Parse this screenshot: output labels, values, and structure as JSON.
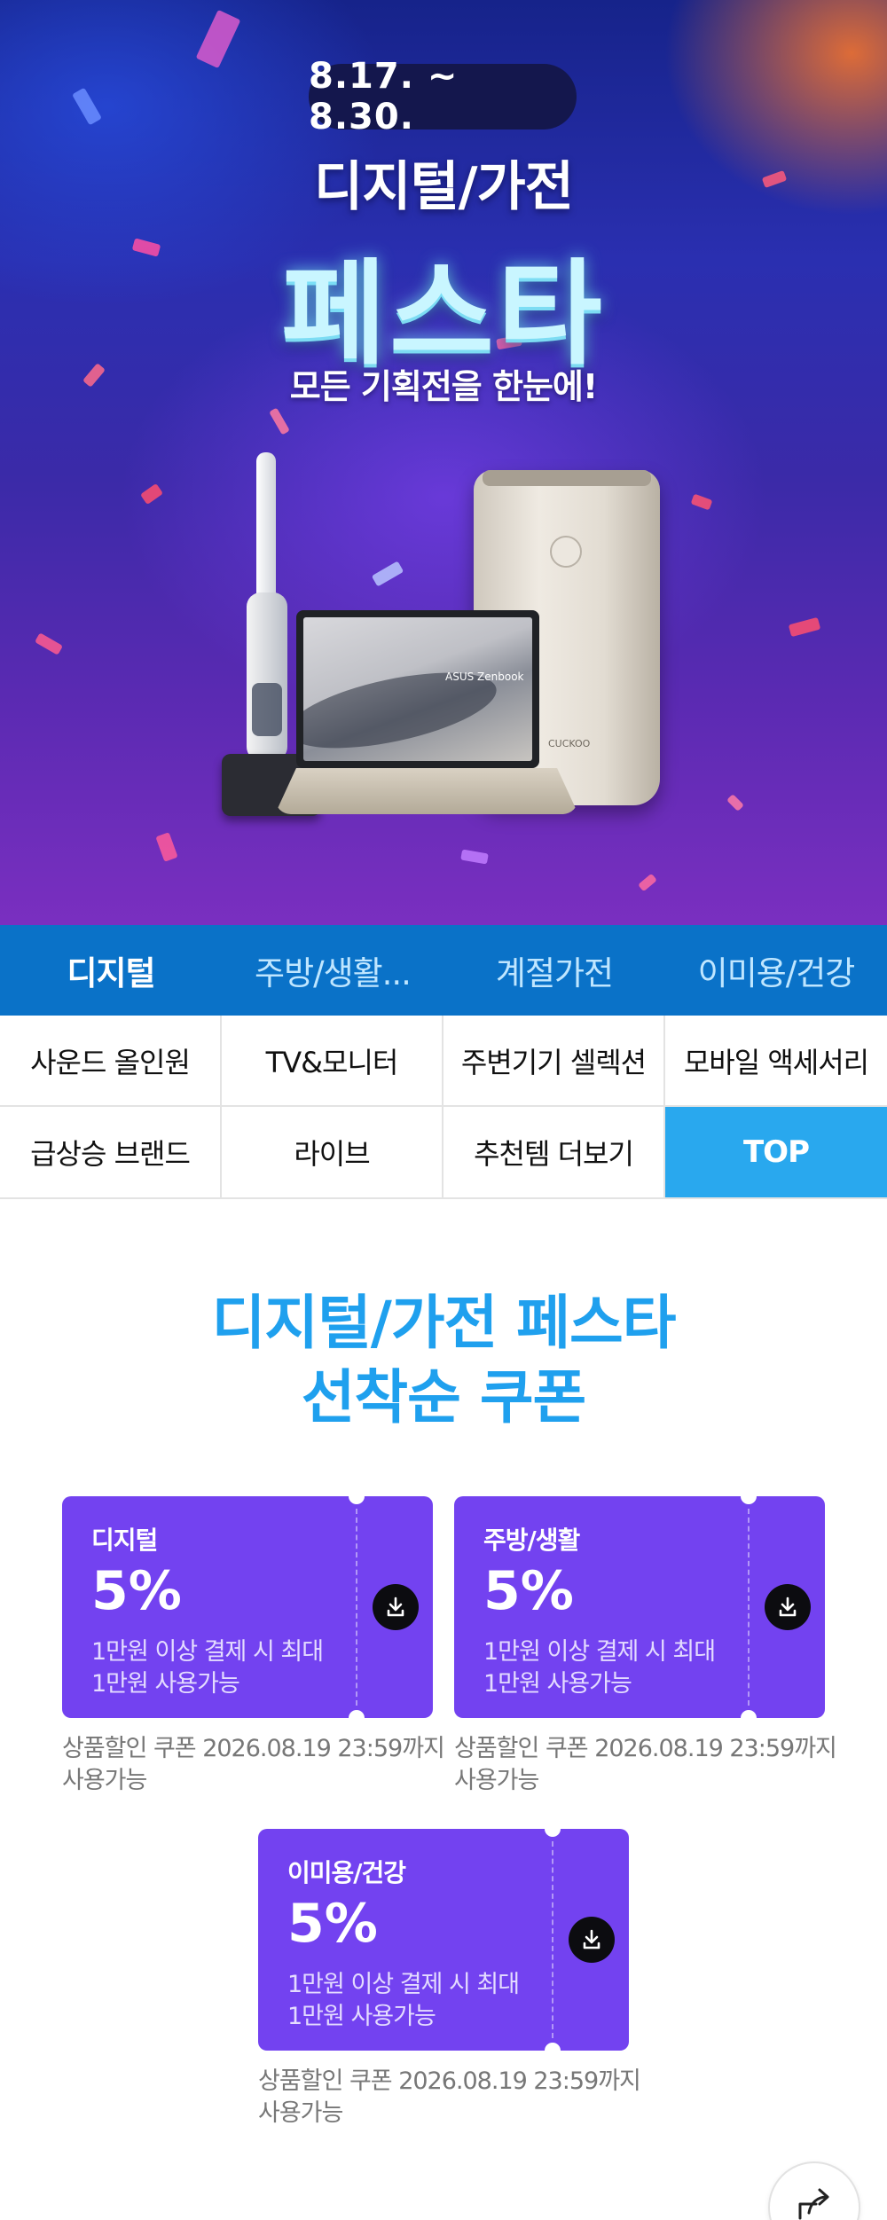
{
  "hero": {
    "date_range": "8.17. ~ 8.30.",
    "title_line1": "디지털/가전",
    "title_line2": "페스타",
    "subtitle": "모든 기획전을 한눈에!",
    "laptop_brand": "ASUS Zenbook",
    "purifier_brand": "CUCKOO"
  },
  "category_tabs": [
    {
      "label": "디지털",
      "active": true
    },
    {
      "label": "주방/생활...",
      "active": false
    },
    {
      "label": "계절가전",
      "active": false
    },
    {
      "label": "이미용/건강",
      "active": false
    }
  ],
  "sub_nav": [
    "사운드 올인원",
    "TV&모니터",
    "주변기기 셀렉션",
    "모바일 액세서리",
    "급상승 브랜드",
    "라이브",
    "추천템 더보기",
    "TOP"
  ],
  "coupon_section": {
    "title_line1": "디지털/가전 페스타",
    "title_line2": "선착순 쿠폰"
  },
  "coupons": [
    {
      "name": "디지털",
      "percent": "5%",
      "desc_line1": "1만원 이상 결제 시 최대",
      "desc_line2": "1만원 사용가능",
      "note_line1": "상품할인 쿠폰 2026.08.19 23:59까지",
      "note_line2": "사용가능"
    },
    {
      "name": "주방/생활",
      "percent": "5%",
      "desc_line1": "1만원 이상 결제 시 최대",
      "desc_line2": "1만원 사용가능",
      "note_line1": "상품할인 쿠폰 2026.08.19 23:59까지",
      "note_line2": "사용가능"
    },
    {
      "name": "이미용/건강",
      "percent": "5%",
      "desc_line1": "1만원 이상 결제 시 최대",
      "desc_line2": "1만원 사용가능",
      "note_line1": "상품할인 쿠폰 2026.08.19 23:59까지",
      "note_line2": "사용가능"
    }
  ],
  "colors": {
    "tab_bar": "#0a72c8",
    "top_cell": "#29a8ee",
    "coupon": "#7342f0",
    "title_blue": "#1fa0ee"
  },
  "icons": {
    "coupon_download": "download-icon",
    "share": "share-icon"
  }
}
